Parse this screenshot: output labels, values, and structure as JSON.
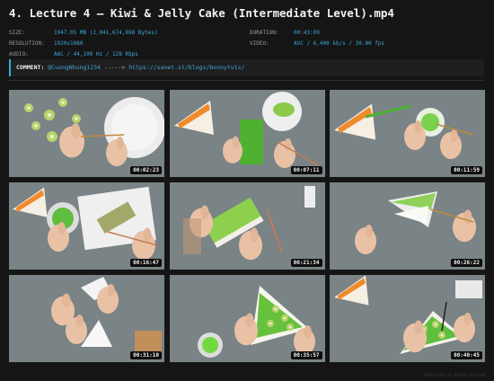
{
  "title": "4. Lecture 4 – Kiwi & Jelly Cake (Intermediate Level).mp4",
  "meta": {
    "size_label": "SIZE:",
    "size_value": "1947.05 MB (2,041,674,898 Bytes)",
    "duration_label": "DURATION:",
    "duration_value": "00:43:09",
    "resolution_label": "RESOLUTION:",
    "resolution_value": "1920x1080",
    "video_label": "VIDEO:",
    "video_value": "AVC / 6,400 kb/s / 30.00 fps",
    "audio_label": "AUDIO:",
    "audio_value": "AAC / 44,100 Hz / 128 Kbps"
  },
  "comment": {
    "label": "COMMENT:",
    "user": "@CuongNhung1234",
    "arrow": "----->",
    "url": "https://sanet.st/blogs/bonnytuts/"
  },
  "thumbnails": [
    {
      "timestamp": "00:02:23",
      "scene": "kiwi-slices-plate"
    },
    {
      "timestamp": "00:07:11",
      "scene": "green-jelly-strips"
    },
    {
      "timestamp": "00:11:59",
      "scene": "cake-slice-brush"
    },
    {
      "timestamp": "00:16:47",
      "scene": "jelly-bowl-board"
    },
    {
      "timestamp": "00:21:34",
      "scene": "jelly-layer-hands"
    },
    {
      "timestamp": "00:26:22",
      "scene": "cake-wedge-hands"
    },
    {
      "timestamp": "00:31:10",
      "scene": "wrapping-cake"
    },
    {
      "timestamp": "00:35:57",
      "scene": "kiwi-cake-wedge"
    },
    {
      "timestamp": "00:40:45",
      "scene": "finished-cakes"
    }
  ],
  "watermark": "GENERATED BY VIDEO PREVIEW"
}
